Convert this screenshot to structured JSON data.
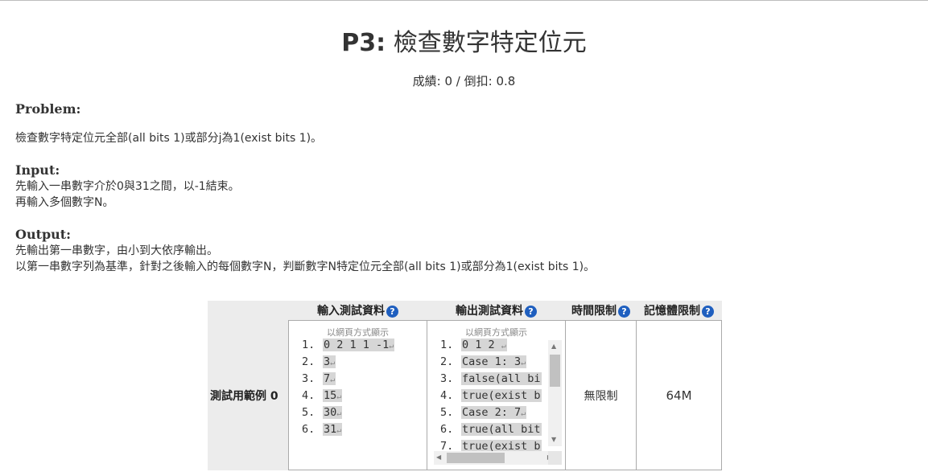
{
  "header": {
    "title_prefix": "P3:",
    "title_text": "檢查數字特定位元",
    "score_line": "成績: 0 / 倒扣: 0.8"
  },
  "problem": {
    "heading": "Problem:",
    "text": "檢查數字特定位元全部(all bits 1)或部分j為1(exist bits 1)。"
  },
  "input": {
    "heading": "Input:",
    "lines": [
      "先輸入一串數字介於0與31之間，以-1結束。",
      "再輸入多個數字N。"
    ]
  },
  "output": {
    "heading": "Output:",
    "lines": [
      "先輸出第一串數字，由小到大依序輸出。",
      "以第一串數字列為基準，針對之後輸入的每個數字N，判斷數字N特定位元全部(all bits 1)或部分為1(exist bits 1)。"
    ]
  },
  "table": {
    "headers": [
      "輸入測試資料",
      "輸出測試資料",
      "時間限制",
      "記憶體限制"
    ],
    "help_icon": "?",
    "row_label": "測試用範例 0",
    "input_caption": "以網頁方式顯示",
    "input_lines": [
      {
        "num": "1.",
        "text": "0 2 1 1 -1"
      },
      {
        "num": "2.",
        "text": "3"
      },
      {
        "num": "3.",
        "text": "7"
      },
      {
        "num": "4.",
        "text": "15"
      },
      {
        "num": "5.",
        "text": "30"
      },
      {
        "num": "6.",
        "text": "31"
      }
    ],
    "output_caption": "以網頁方式顯示",
    "output_lines": [
      {
        "num": "1.",
        "text": "0 1 2 "
      },
      {
        "num": "2.",
        "text": "Case 1: 3"
      },
      {
        "num": "3.",
        "text": "false(all bi"
      },
      {
        "num": "4.",
        "text": "true(exist b"
      },
      {
        "num": "5.",
        "text": "Case 2: 7"
      },
      {
        "num": "6.",
        "text": "true(all bit"
      },
      {
        "num": "7.",
        "text": "true(exist b"
      }
    ],
    "time_limit": "無限制",
    "memory_limit": "64M",
    "return_glyph": "↵"
  },
  "colors": {
    "help_icon": "#1f5fbf",
    "header_bg": "#ececec",
    "highlight": "#d6d6d6"
  }
}
